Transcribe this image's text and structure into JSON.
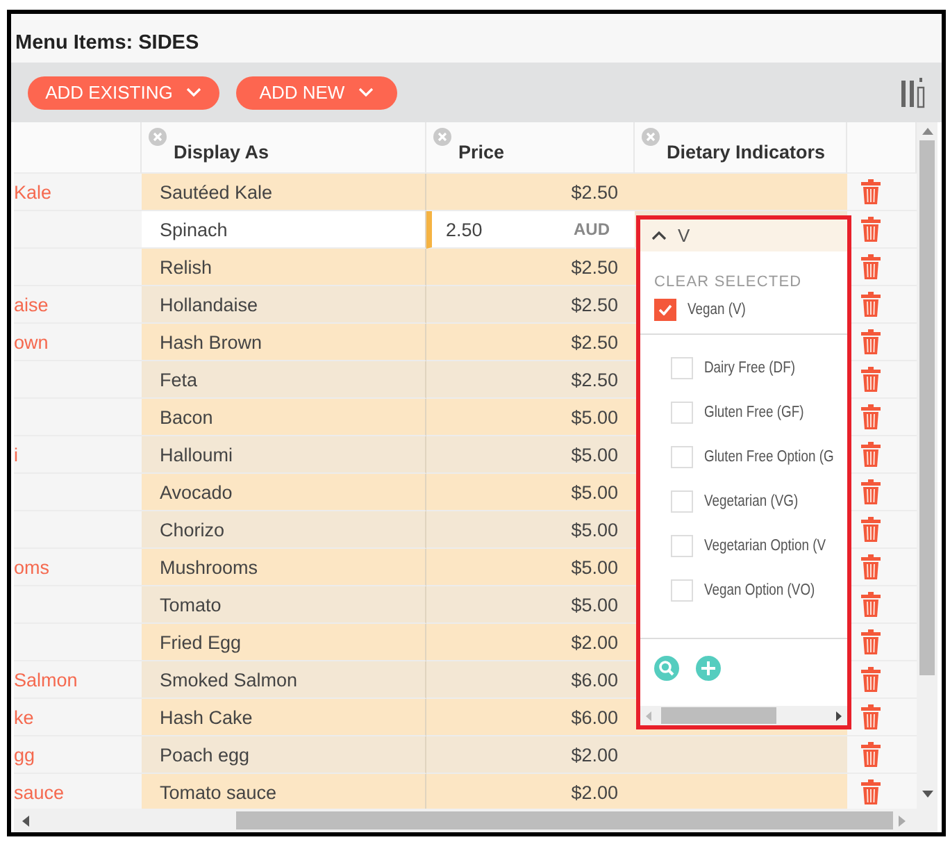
{
  "title": "Menu Items: SIDES",
  "toolbar": {
    "buttons": [
      {
        "label": "ADD EXISTING"
      },
      {
        "label": "ADD NEW"
      }
    ]
  },
  "table": {
    "columns": [
      "Display As",
      "Price",
      "Dietary Indicators"
    ],
    "rows": [
      {
        "column_1": "Kale",
        "display_as": "Sautéed Kale",
        "price": "$2.50",
        "editing": false
      },
      {
        "display_as": "Spinach",
        "price": "2.50",
        "currency": "AUD",
        "editing": true
      },
      {
        "display_as": "Relish",
        "price": "$2.50",
        "editing": false
      },
      {
        "column_1": "aise",
        "display_as": "Hollandaise",
        "price": "$2.50",
        "editing": false
      },
      {
        "column_1": "own",
        "display_as": "Hash Brown",
        "price": "$2.50",
        "editing": false
      },
      {
        "display_as": "Feta",
        "price": "$2.50",
        "editing": false
      },
      {
        "display_as": "Bacon",
        "price": "$5.00",
        "editing": false
      },
      {
        "column_1": "i",
        "display_as": "Halloumi",
        "price": "$5.00",
        "editing": false
      },
      {
        "display_as": "Avocado",
        "price": "$5.00",
        "editing": false
      },
      {
        "display_as": "Chorizo",
        "price": "$5.00",
        "editing": false
      },
      {
        "column_1": "oms",
        "display_as": "Mushrooms",
        "price": "$5.00",
        "editing": false
      },
      {
        "display_as": "Tomato",
        "price": "$5.00",
        "editing": false
      },
      {
        "display_as": "Fried Egg",
        "price": "$2.00",
        "editing": false
      },
      {
        "column_1": "Salmon",
        "display_as": "Smoked Salmon",
        "price": "$6.00",
        "editing": false
      },
      {
        "column_1": "ke",
        "display_as": "Hash Cake",
        "price": "$6.00",
        "editing": false
      },
      {
        "column_1": "gg",
        "display_as": "Poach egg",
        "price": "$2.00",
        "editing": false
      },
      {
        "column_1": "sauce",
        "display_as": "Tomato sauce",
        "price": "$2.00",
        "editing": false
      }
    ]
  },
  "dietary_dropdown": {
    "value": "V",
    "expanded": true,
    "clear_label": "CLEAR SELECTED",
    "options": [
      {
        "label": "Vegan (V)",
        "checked": true
      },
      {
        "label": "Dairy Free (DF)",
        "checked": false
      },
      {
        "label": "Gluten Free (GF)",
        "checked": false
      },
      {
        "label": "Gluten Free Option (G",
        "checked": false
      },
      {
        "label": "Vegetarian (VG)",
        "checked": false
      },
      {
        "label": "Vegetarian Option (V",
        "checked": false
      },
      {
        "label": "Vegan Option (VO)",
        "checked": false
      }
    ]
  }
}
